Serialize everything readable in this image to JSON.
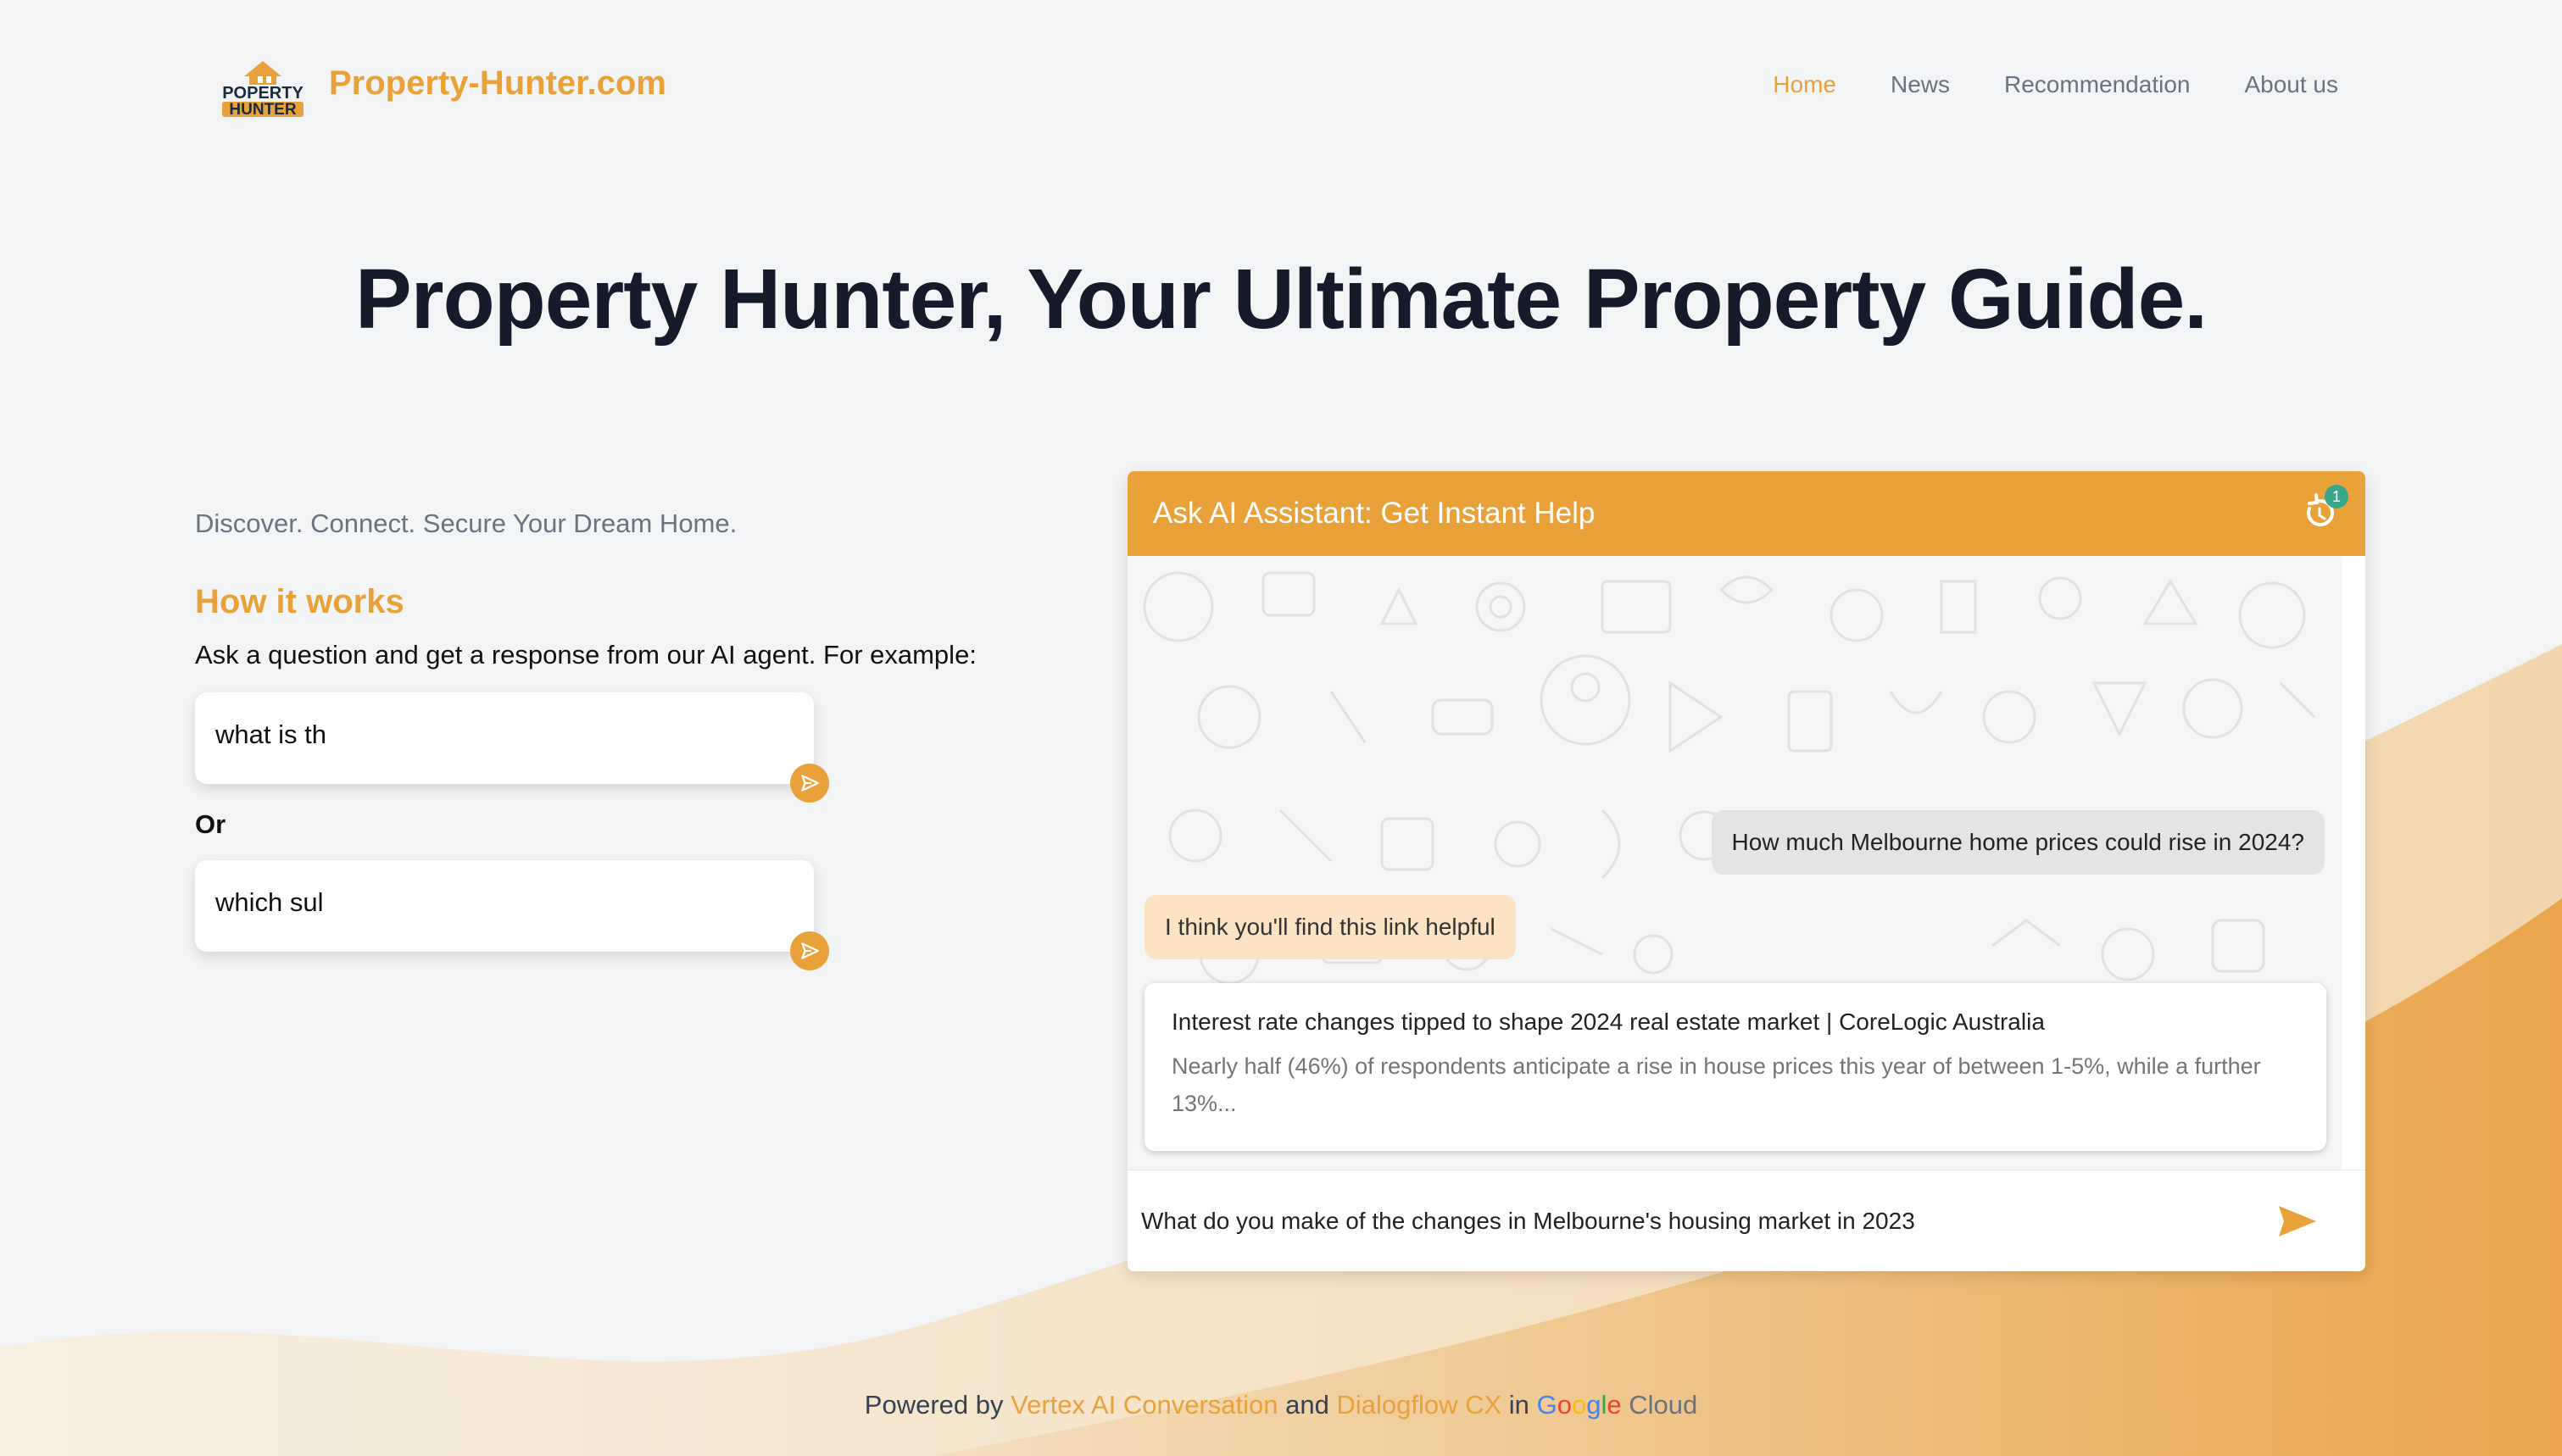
{
  "brand": {
    "logo_text_top": "POPERTY",
    "logo_text_bottom": "HUNTER",
    "name": "Property-Hunter.com"
  },
  "nav": {
    "items": [
      {
        "label": "Home",
        "active": true
      },
      {
        "label": "News"
      },
      {
        "label": "Recommendation"
      },
      {
        "label": "About us"
      }
    ]
  },
  "hero": {
    "title": "Property Hunter, Your Ultimate Property Guide."
  },
  "left": {
    "tagline": "Discover. Connect. Secure Your Dream Home.",
    "how_title": "How it works",
    "ask_text": "Ask a question and get a response from our AI agent. For example:",
    "example1": "what is th",
    "or_label": "Or",
    "example2": "which sul"
  },
  "chat": {
    "title": "Ask AI Assistant: Get Instant Help",
    "badge": "1",
    "user_message": "How much Melbourne home prices could rise in 2024?",
    "bot_message": "I think you'll find this link helpful",
    "card": {
      "title": "Interest rate changes tipped to shape 2024 real estate market | CoreLogic Australia",
      "desc": "Nearly half (46%) of respondents anticipate a rise in house prices this year of between 1-5%, while a further 13%..."
    },
    "input_value": "What do you make of the changes in Melbourne's housing market in 2023"
  },
  "footer": {
    "powered_by": "Powered by",
    "vertex": "Vertex AI Conversation",
    "and": "and",
    "dialogflow": "Dialogflow CX",
    "in": "in",
    "google": [
      "G",
      "o",
      "o",
      "g",
      "l",
      "e"
    ],
    "cloud": "Cloud"
  },
  "colors": {
    "accent": "#e9a13a",
    "heading": "#161b2b",
    "muted": "#6b7280"
  }
}
